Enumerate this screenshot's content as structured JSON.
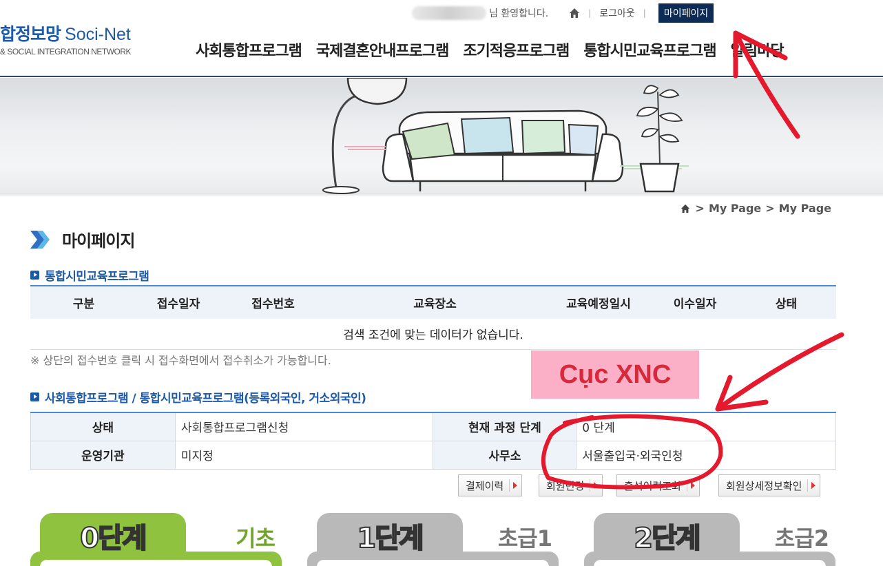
{
  "header": {
    "logo_ko": "합정보망",
    "logo_en": "Soci-Net",
    "logo_sub": "& SOCIAL INTEGRATION NETWORK",
    "welcome": "님 환영합니다.",
    "logout": "로그아웃",
    "mypage": "마이페이지"
  },
  "nav": {
    "items": [
      {
        "label": "사회통합프로그램"
      },
      {
        "label": "국제결혼안내프로그램"
      },
      {
        "label": "조기적응프로그램"
      },
      {
        "label": "통합시민교육프로그램"
      },
      {
        "label": "알림마당"
      }
    ]
  },
  "breadcrumb": {
    "sep1": ">",
    "item1": "My Page",
    "sep2": ">",
    "item2": "My Page"
  },
  "page": {
    "title": "마이페이지"
  },
  "section1": {
    "title": "통합시민교육프로그램",
    "columns": [
      "구분",
      "접수일자",
      "접수번호",
      "교육장소",
      "교육예정일시",
      "이수일자",
      "상태"
    ],
    "empty_message": "검색 조건에 맞는 데이터가 없습니다.",
    "note": "※ 상단의 접수번호 클릭 시 접수화면에서 접수취소가 가능합니다."
  },
  "section2": {
    "title": "사회통합프로그램 / 통합시민교육프로그램(등록외국인, 거소외국인)",
    "status_label": "상태",
    "status_value": "사회통합프로그램신청",
    "stage_label": "현재 과정 단계",
    "stage_value": "0 단계",
    "org_label": "운영기관",
    "org_value": "미지정",
    "office_label": "사무소",
    "office_value": "서울출입국·외국인청"
  },
  "buttons": {
    "payment": "결제이력",
    "change": "회원변경",
    "history": "출석이력조회",
    "member": "회원상세정보확인"
  },
  "stages": [
    {
      "num": "0단계",
      "level": "기초"
    },
    {
      "num": "1단계",
      "level": "초급1"
    },
    {
      "num": "2단계",
      "level": "초급2"
    }
  ],
  "annotation": {
    "label": "Cục XNC"
  },
  "colors": {
    "navy": "#0d2b55",
    "brand_blue": "#1d5aa8",
    "table_line": "#4a8ad0",
    "stage_green": "#8ec23f",
    "stage_gray": "#b9b9b9",
    "annotation_red": "#e5192d",
    "annotation_pink": "#fbb0c8"
  }
}
